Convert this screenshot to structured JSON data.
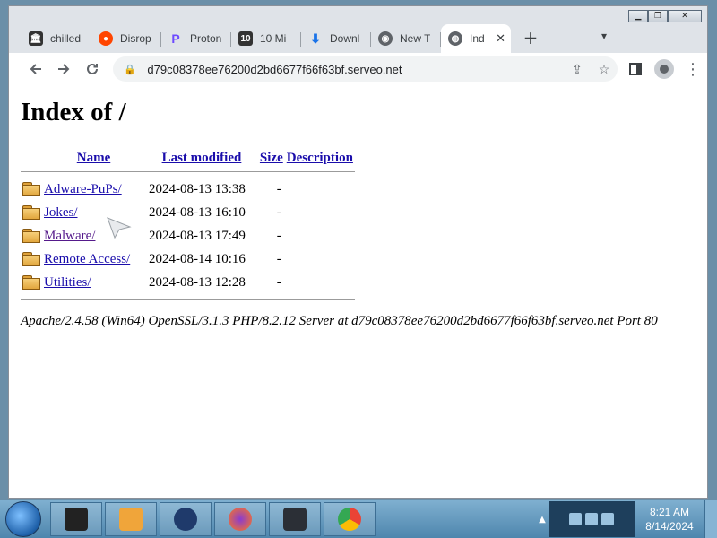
{
  "browser": {
    "tabs": [
      {
        "label": "chilled",
        "icon": "building-icon",
        "color": "#333333"
      },
      {
        "label": "Disrop",
        "icon": "reddit-icon",
        "color": "#ff4500"
      },
      {
        "label": "Proton",
        "icon": "proton-icon",
        "color": "#6d4aff"
      },
      {
        "label": "10 Mi",
        "icon": "ten-minute-mail-icon",
        "color": "#333333"
      },
      {
        "label": "Downl",
        "icon": "download-icon",
        "color": "#1a73e8"
      },
      {
        "label": "New T",
        "icon": "chrome-icon",
        "color": "#5f6368"
      },
      {
        "label": "Ind",
        "icon": "globe-icon",
        "color": "#5f6368",
        "active": true
      }
    ],
    "new_tab": "+",
    "url": "d79c08378ee76200d2bd6677f66f63bf.serveo.net"
  },
  "page": {
    "title": "Index of /",
    "columns": {
      "name": "Name",
      "modified": "Last modified",
      "size": "Size",
      "description": "Description"
    },
    "rows": [
      {
        "name": "Adware-PuPs/",
        "modified": "2024-08-13 13:38",
        "size": "-",
        "visited": false
      },
      {
        "name": "Jokes/",
        "modified": "2024-08-13 16:10",
        "size": "-",
        "visited": false
      },
      {
        "name": "Malware/",
        "modified": "2024-08-13 17:49",
        "size": "-",
        "visited": true
      },
      {
        "name": "Remote Access/",
        "modified": "2024-08-14 10:16",
        "size": "-",
        "visited": false
      },
      {
        "name": "Utilities/",
        "modified": "2024-08-13 12:28",
        "size": "-",
        "visited": false
      }
    ],
    "footer": "Apache/2.4.58 (Win64) OpenSSL/3.1.3 PHP/8.2.12 Server at d79c08378ee76200d2bd6677f66f63bf.serveo.net Port 80"
  },
  "taskbar": {
    "apps": [
      "terminal-icon",
      "media-player-icon",
      "firefox-dark-icon",
      "firefox-icon",
      "window-app-icon",
      "chrome-icon"
    ],
    "time": "8:21 AM",
    "date": "8/14/2024"
  }
}
